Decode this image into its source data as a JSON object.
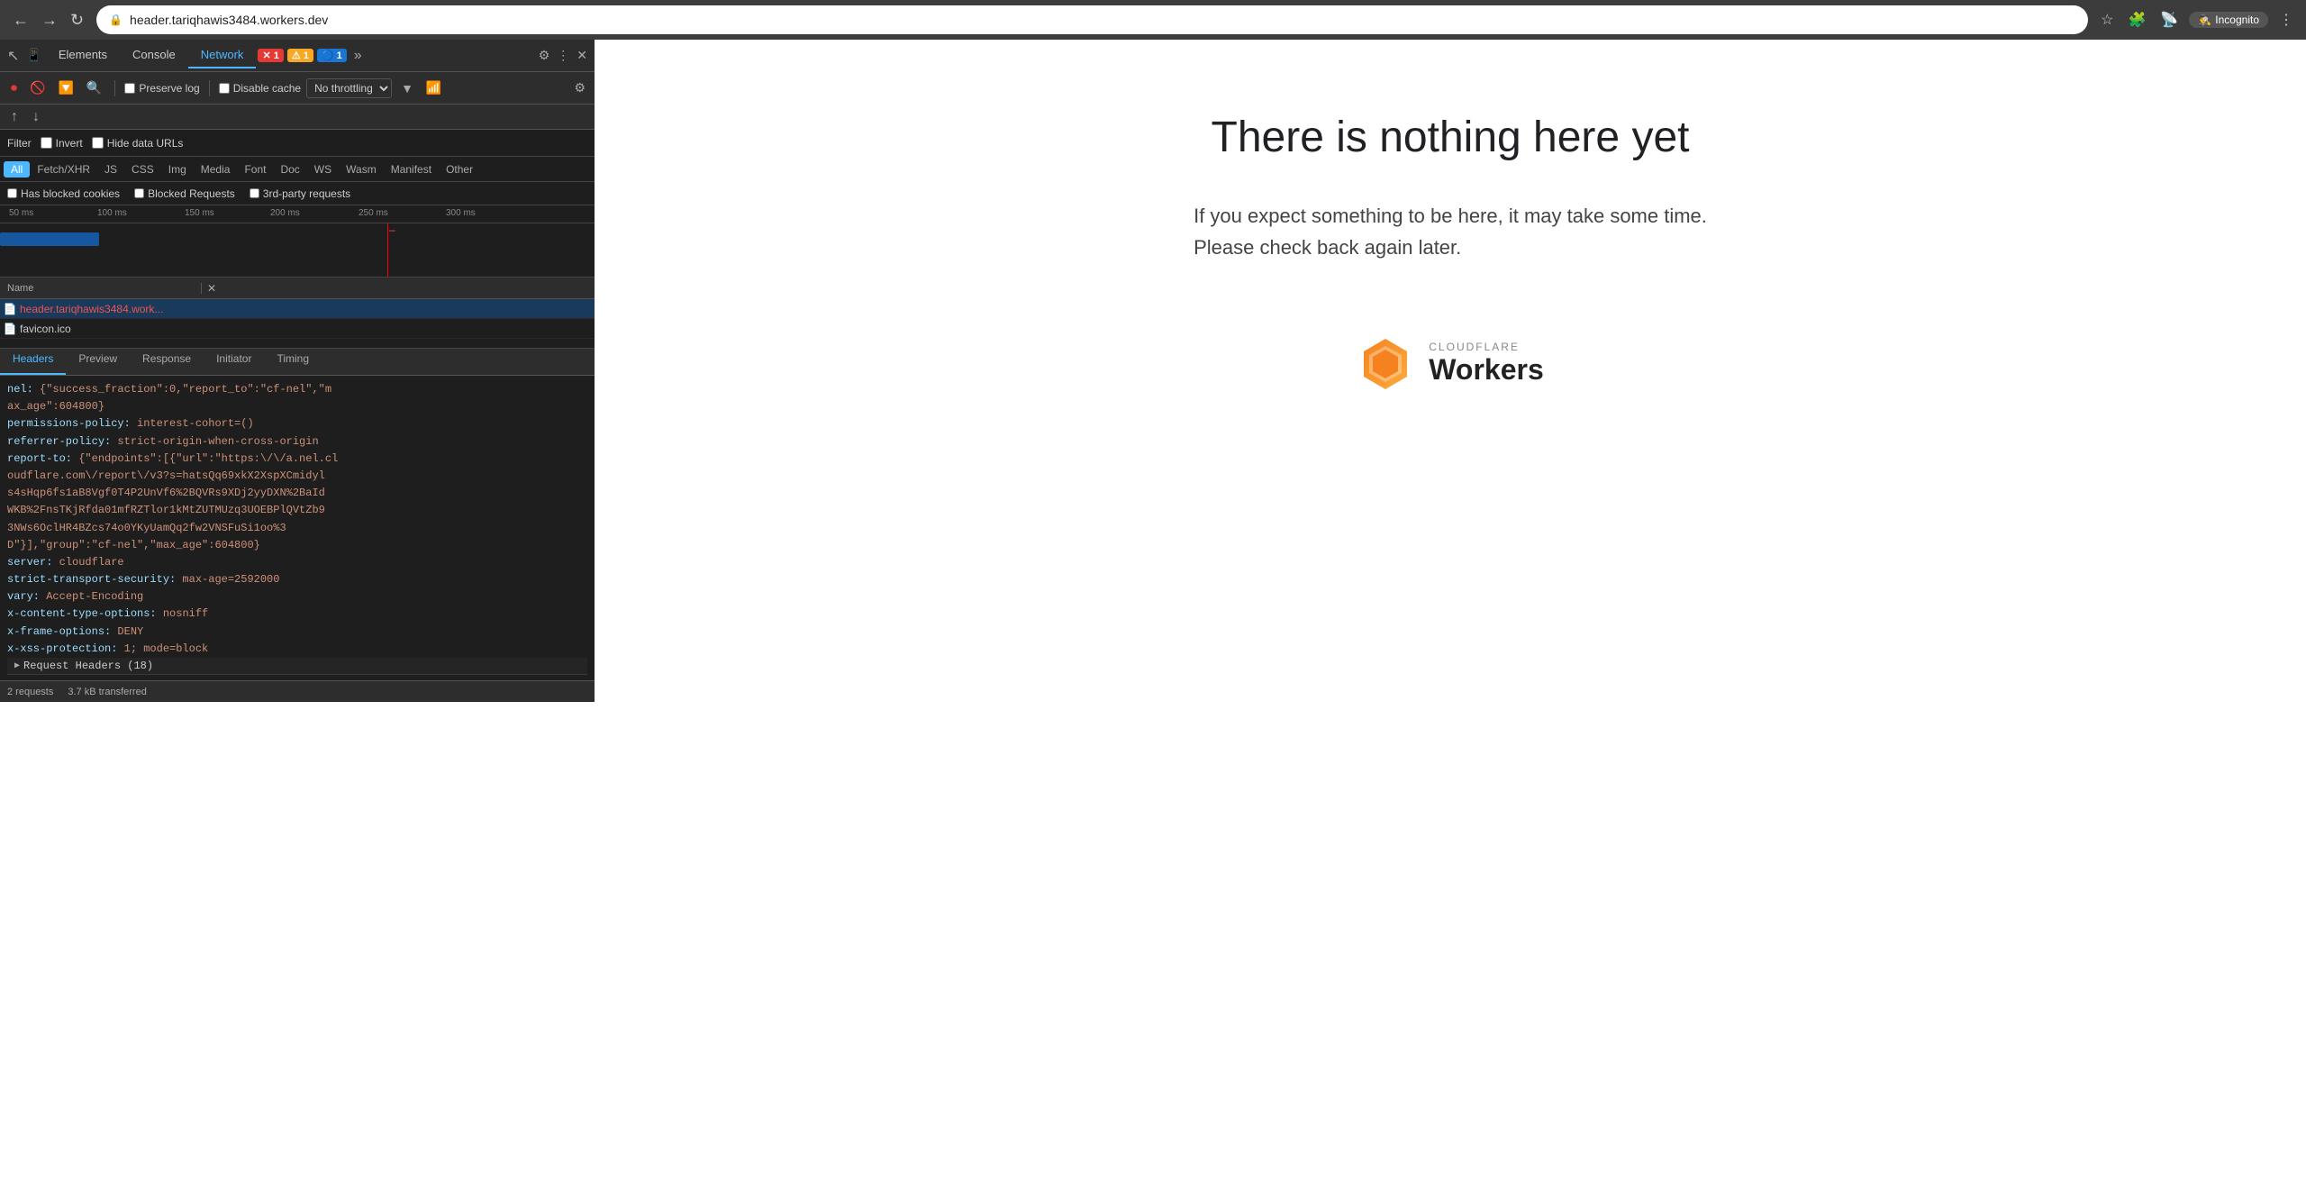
{
  "browser": {
    "url": "header.tariqhawis3484.workers.dev",
    "incognito_label": "Incognito"
  },
  "devtools": {
    "tabs": [
      {
        "label": "Elements",
        "active": false
      },
      {
        "label": "Console",
        "active": false
      },
      {
        "label": "Network",
        "active": true
      },
      {
        "label": "More",
        "active": false
      }
    ],
    "badges": {
      "error": "✕ 1",
      "warning": "⚠ 1",
      "info": "🔵 1"
    },
    "toolbar": {
      "preserve_log": "Preserve log",
      "disable_cache": "Disable cache",
      "throttle_label": "No throttling",
      "gear": "⚙"
    },
    "filter": {
      "label": "Filter",
      "invert": "Invert",
      "hide_data_urls": "Hide data URLs"
    },
    "type_tabs": [
      "All",
      "Fetch/XHR",
      "JS",
      "CSS",
      "Img",
      "Media",
      "Font",
      "Doc",
      "WS",
      "Wasm",
      "Manifest",
      "Other"
    ],
    "active_type": "All",
    "checkboxes": {
      "has_blocked_cookies": "Has blocked cookies",
      "blocked_requests": "Blocked Requests",
      "third_party": "3rd-party requests"
    },
    "timeline": {
      "ticks": [
        "50 ms",
        "100 ms",
        "150 ms",
        "200 ms",
        "250 ms",
        "300 ms"
      ]
    },
    "requests": {
      "header_col": "Name",
      "items": [
        {
          "name": "header.tariqhawis3484.work...",
          "type": "red",
          "selected": true
        },
        {
          "name": "favicon.ico",
          "type": "gray",
          "selected": false
        }
      ]
    },
    "detail_tabs": [
      "Headers",
      "Preview",
      "Response",
      "Initiator",
      "Timing"
    ],
    "active_detail_tab": "Headers",
    "headers_content": [
      {
        "key": "nel:",
        "val": " {\"success_fraction\":0,\"report_to\":\"cf-nel\",\"m"
      },
      {
        "key": "",
        "val": "ax_age\":604800}"
      },
      {
        "key": "permissions-policy:",
        "val": " interest-cohort=()"
      },
      {
        "key": "referrer-policy:",
        "val": " strict-origin-when-cross-origin"
      },
      {
        "key": "report-to:",
        "val": " {\"endpoints\":[{\"url\":\"https:\\/\\/a.nel.cl"
      },
      {
        "key": "",
        "val": "oudflare.com\\/report\\/v3?s=hatsQq69xkX2XspXCmidyl"
      },
      {
        "key": "",
        "val": "s4sHqp6fs1aB8Vgf0T4P2UnVf6%2BQVRs9XDj2yyDXN%2BaId"
      },
      {
        "key": "",
        "val": "WKB%2FnsTKjRfda01mfRZTlor1kMtZUTMUzq3UOEBPlQVtZb9"
      },
      {
        "key": "",
        "val": "3NWs6OclHR4BZcs74o0YKyUamQq2fw2VNSFuSi1oo%3"
      },
      {
        "key": "",
        "val": "D\"}],\"group\":\"cf-nel\",\"max_age\":604800}"
      },
      {
        "key": "server:",
        "val": " cloudflare"
      },
      {
        "key": "strict-transport-security:",
        "val": " max-age=2592000"
      },
      {
        "key": "vary:",
        "val": " Accept-Encoding"
      },
      {
        "key": "x-content-type-options:",
        "val": " nosniff"
      },
      {
        "key": "x-frame-options:",
        "val": " DENY"
      },
      {
        "key": "x-xss-protection:",
        "val": " 1; mode=block"
      }
    ],
    "request_headers_section": "Request Headers (18)",
    "status_bar": {
      "requests": "2 requests",
      "transferred": "3.7 kB transferred"
    }
  },
  "page": {
    "heading": "There is nothing here yet",
    "subtext_line1": "If you expect something to be here, it may take some time.",
    "subtext_line2": "Please check back again later.",
    "cloudflare_brand_top": "CLOUDFLARE",
    "cloudflare_brand_bottom": "Workers"
  }
}
